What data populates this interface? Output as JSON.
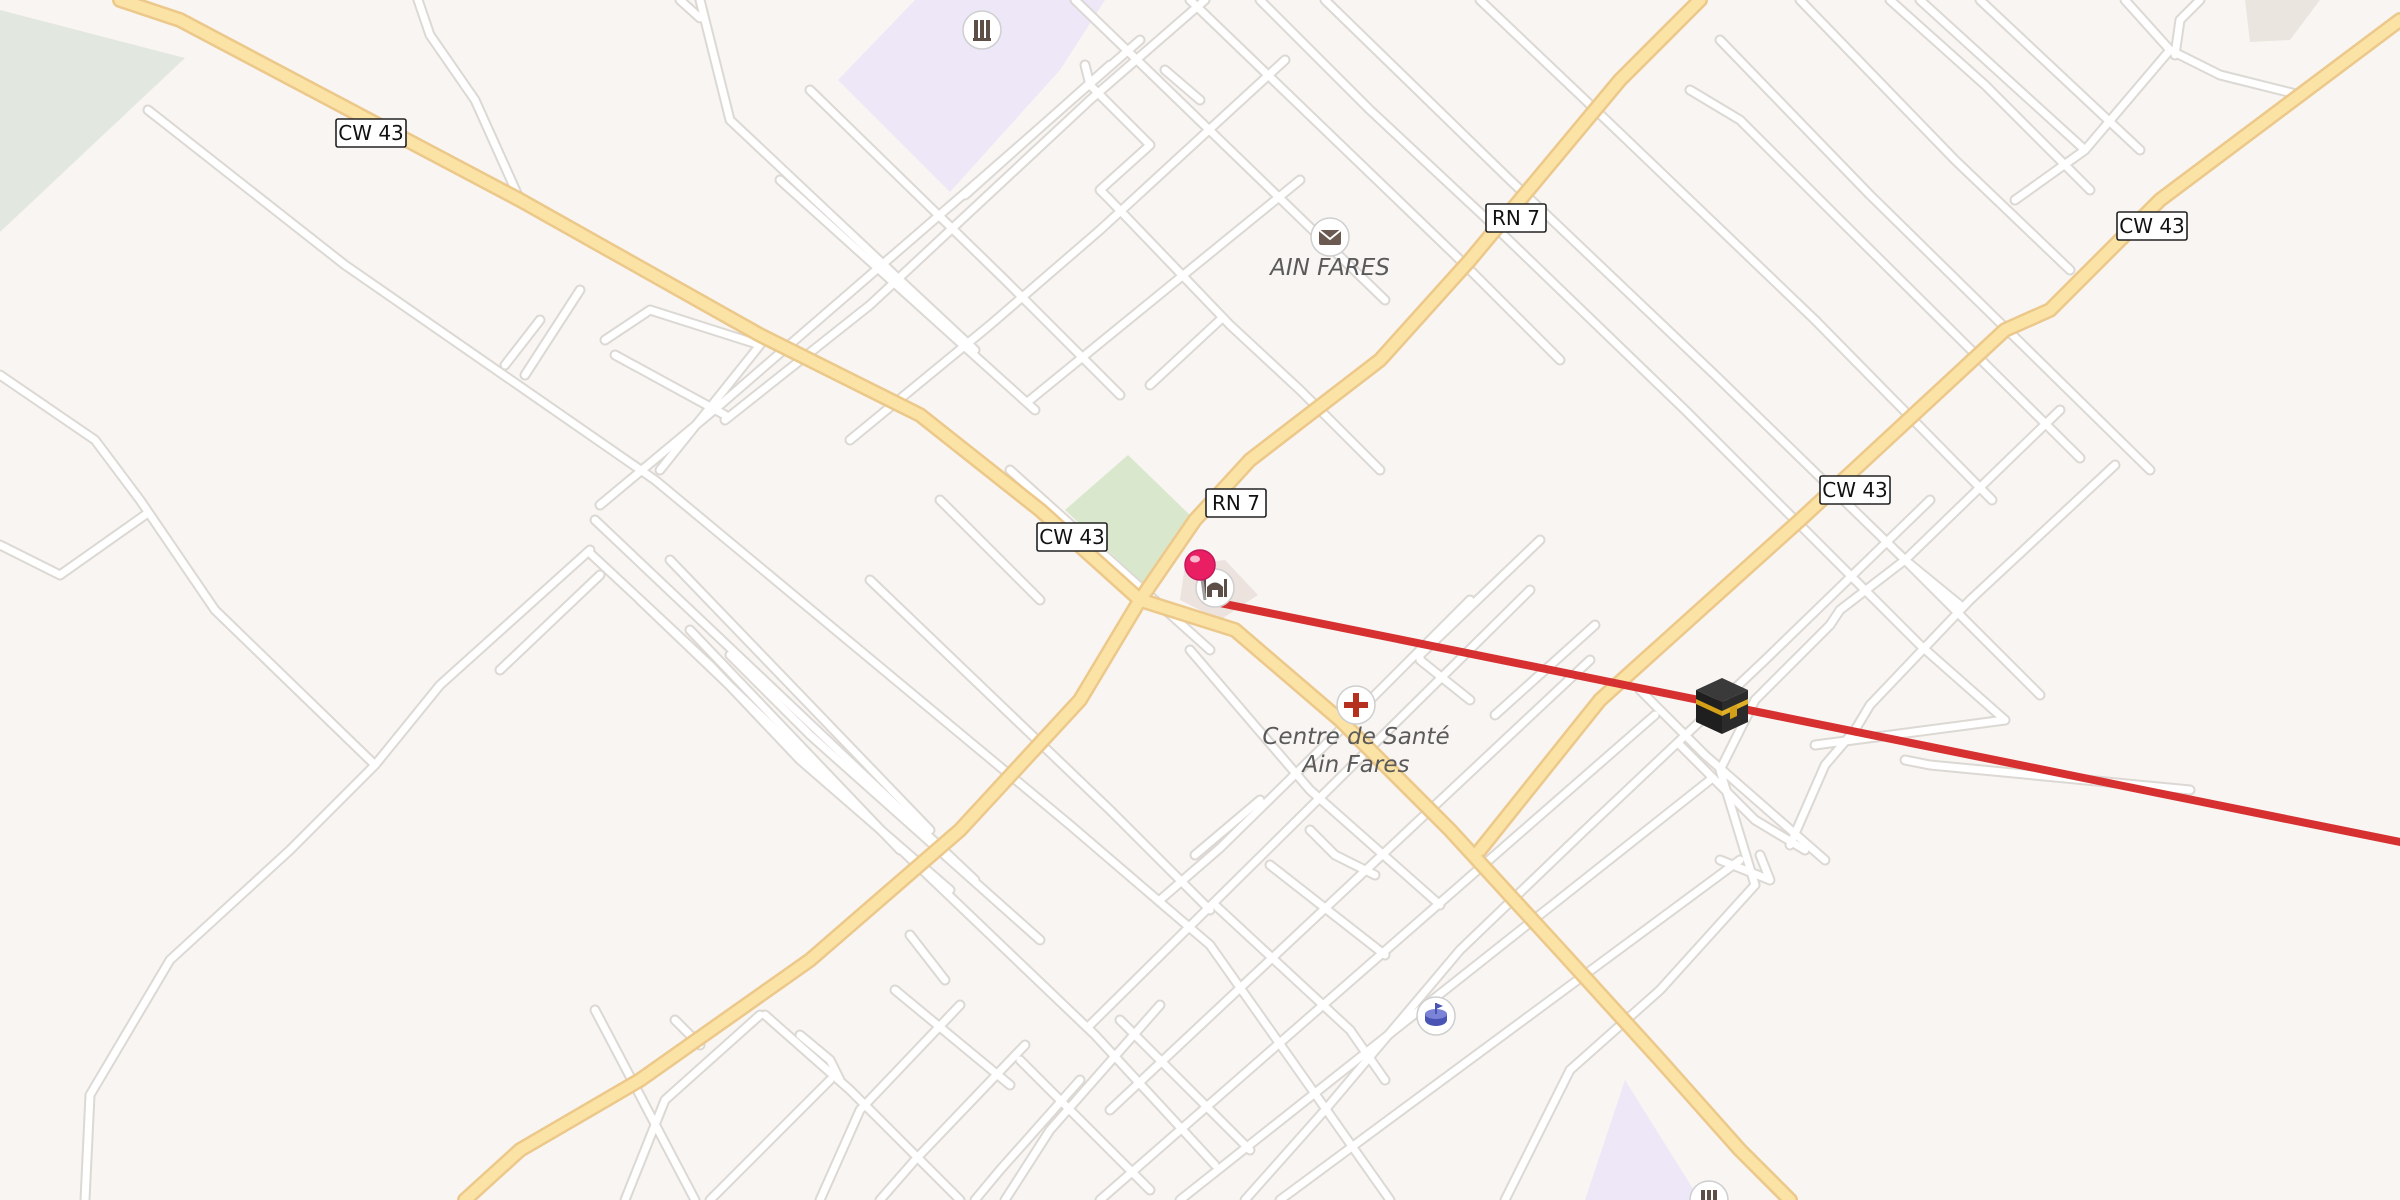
{
  "map": {
    "road_labels": [
      {
        "id": "cw43-a",
        "text": "CW 43"
      },
      {
        "id": "cw43-b",
        "text": "CW 43"
      },
      {
        "id": "cw43-c",
        "text": "CW 43"
      },
      {
        "id": "cw43-d",
        "text": "CW 43"
      },
      {
        "id": "rn7-a",
        "text": "RN 7"
      },
      {
        "id": "rn7-b",
        "text": "RN 7"
      }
    ],
    "places": {
      "town": "AIN FARES",
      "health_center_line1": "Centre de Santé",
      "health_center_line2": "Ain Fares"
    },
    "icons": {
      "post_office": "envelope-icon",
      "health": "cross-icon",
      "school": "school-icon",
      "mosque": "mosque-icon",
      "kaaba": "kaaba-icon",
      "stadium": "stadium-icon",
      "pin": "location-pin-icon"
    },
    "colors": {
      "background": "#f8f5f2",
      "minor_road": "#ffffff",
      "minor_road_casing": "#dcd8d4",
      "major_road": "#fbe3a6",
      "major_road_casing": "#ecc88a",
      "qibla_line": "#d63031",
      "pin": "#e91e63",
      "park": "#d9e8cc",
      "school_area": "#ede7f8",
      "forest": "#e2e7e0"
    }
  }
}
